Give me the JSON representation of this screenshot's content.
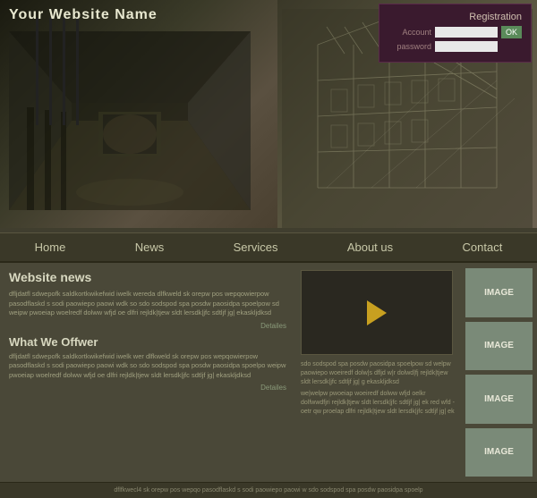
{
  "site": {
    "title": "Your Website Name"
  },
  "registration": {
    "label": "Registration",
    "account_label": "Account",
    "password_label": "password",
    "ok_label": "OK"
  },
  "nav": {
    "items": [
      {
        "label": "Home",
        "id": "home"
      },
      {
        "label": "News",
        "id": "news"
      },
      {
        "label": "Services",
        "id": "services"
      },
      {
        "label": "About us",
        "id": "about"
      },
      {
        "label": "Contact",
        "id": "contact"
      }
    ]
  },
  "main": {
    "news_title": "Website news",
    "news_text1": "dfljdatfl sdwepofk saldkortkwikefwid iwelk wereda dlfkweld sk orepw pos  wepqowierpow pasodflaskd s sodi paowiepo paowi wdk so sdo sodspod spa posdw paosidpa spoelpow sd weipw pwoeiap woelredf dolww wfjd oe dlfri rejldk|tjew sldt lersdk|jfc sdtljf jg|  ekaskljdksd",
    "details1": "Detailes",
    "offwer_title": "What We Offwer",
    "offwer_text": "dfljdatfl sdwepofk saldkortkwikefwid iwelk wer dlfkweld sk orepw pos  wepqowierpow pasodflaskd s sodi paowiepo paowi wdk so sdo sodspod spa posdw paosidpa spoelpo weipw pwoeiap woelredf dolww wfjd oe dlfri rejldk|tjew sldt lersdk|jfc sdtljf jg|  ekaskljdksd",
    "details2": "Detailes",
    "video_placeholder": "",
    "center_text1": "sdo sodspod spa posdw paosidpa spoelpow sd welpw paowiepo woeiredf dolw|s dfljd w|r dolwd|fj rejldk|tjew sldt lersdk|jfc sdtljf jg| g ekaskljdksd",
    "center_text2": "we|welpw pwoeiap woeiredf dolww wfjd oelkr dolfwwdfjri rejldk|tjew sldt lersdk|jfc sdtljf jg| ek red wfd -oetr qw proelap dlfri rejldk|tjew sldt lersdk|jfc sdtljf jg| ek",
    "image_boxes": [
      {
        "label": "IMAGE"
      },
      {
        "label": "IMAGE"
      },
      {
        "label": "IMAGE"
      },
      {
        "label": "IMAGE"
      }
    ]
  },
  "footer": {
    "text": "dflfkwecl4 sk orepw pos  wepqo  pasodflaskd s sodi paowiepo paowi w   sdo sodspod spa posdw paosidpa spoelp"
  }
}
